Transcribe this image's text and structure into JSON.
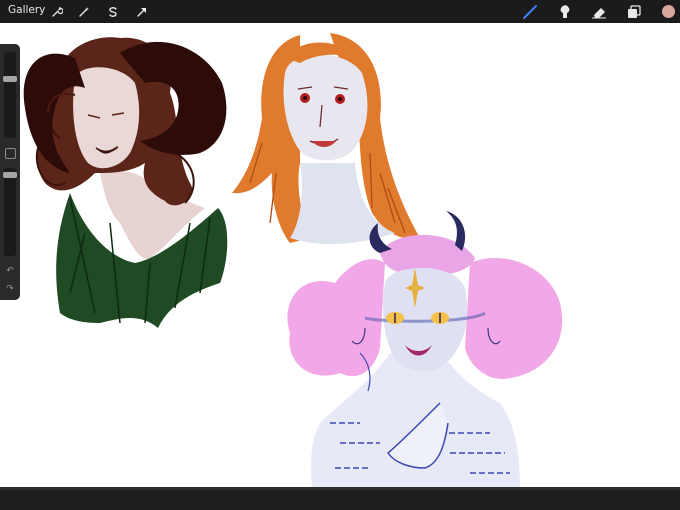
{
  "toolbar": {
    "gallery_label": "Gallery",
    "left_icons": [
      "wrench-icon",
      "magic-wand-icon",
      "selection-icon",
      "transform-arrow-icon"
    ],
    "right_icons": [
      "brush-icon",
      "smudge-icon",
      "eraser-icon",
      "layers-icon",
      "color-swatch-icon"
    ],
    "active_color": "#d9a89d",
    "accent_color": "#3d7fff"
  },
  "sidebar": {
    "brush_size_level": 0.2,
    "opacity_level": 0.05,
    "icons": [
      "modify-square-icon",
      "undo-icon",
      "redo-icon"
    ]
  },
  "canvas": {
    "background": "#ffffff",
    "sketches": [
      "horned-woman-sketch",
      "red-haired-woman-sketch",
      "pink-haired-demon-sketch"
    ]
  }
}
